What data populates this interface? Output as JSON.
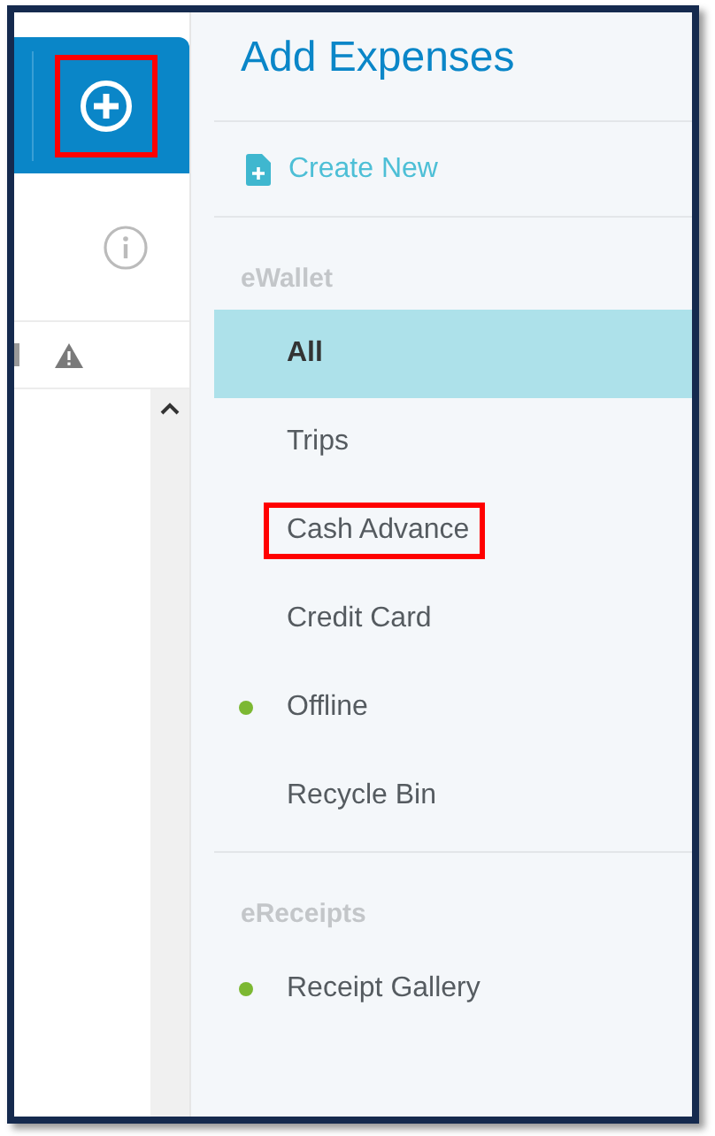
{
  "left_panel": {
    "add_button": {
      "highlighted": true
    }
  },
  "title": "Add Expenses",
  "create_new": "Create New",
  "sections": [
    {
      "heading": "eWallet",
      "items": [
        {
          "label": "All",
          "selected": true,
          "highlighted": false
        },
        {
          "label": "Trips",
          "selected": false,
          "highlighted": false
        },
        {
          "label": "Cash Advance",
          "selected": false,
          "highlighted": true
        },
        {
          "label": "Credit Card",
          "selected": false,
          "highlighted": false
        },
        {
          "label": "Offline",
          "selected": false,
          "highlighted": false,
          "color": "#7cb832"
        },
        {
          "label": "Recycle Bin",
          "selected": false,
          "highlighted": false
        }
      ]
    },
    {
      "heading": "eReceipts",
      "items": [
        {
          "label": "Receipt Gallery",
          "selected": false,
          "highlighted": false,
          "color": "#7cb832"
        }
      ]
    }
  ]
}
